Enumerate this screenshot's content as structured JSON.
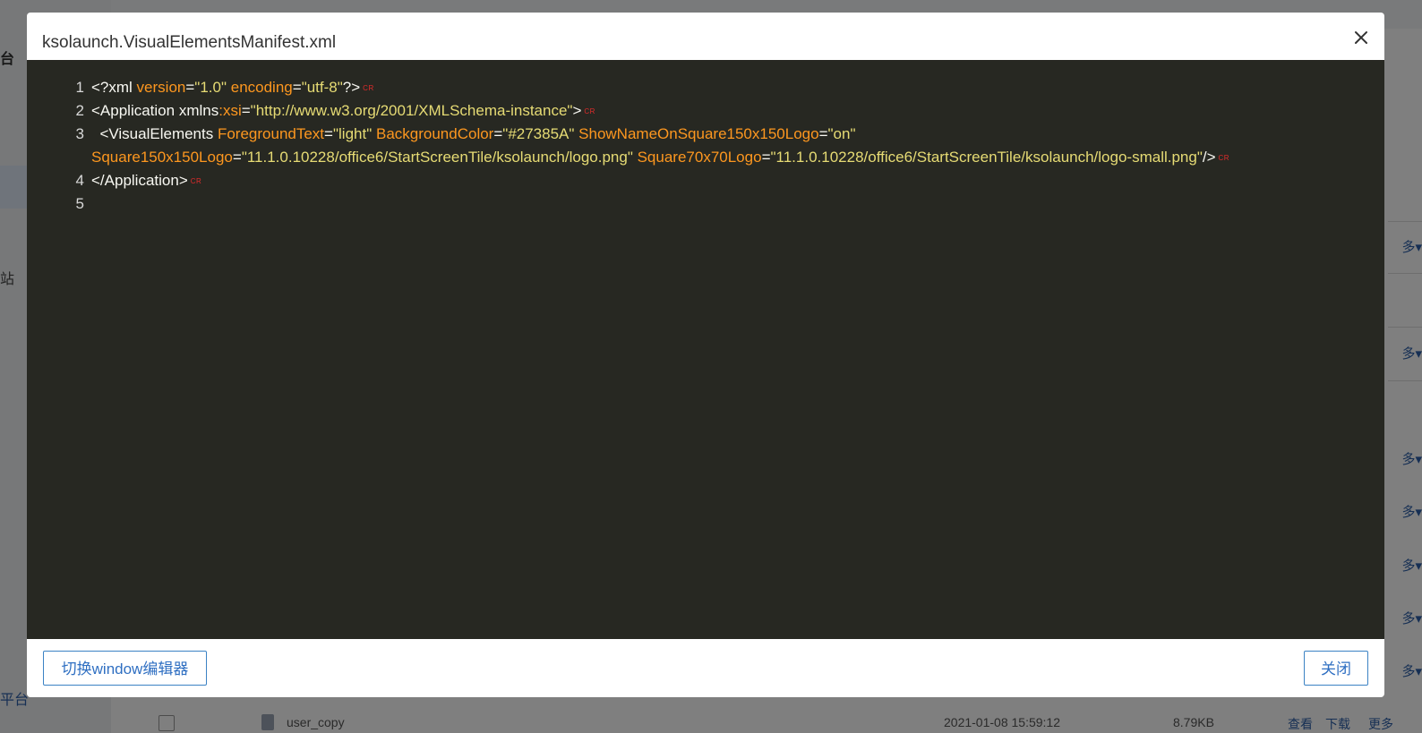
{
  "background": {
    "sidebar_items": [
      "台",
      "站",
      "平台"
    ],
    "more_label": "多",
    "file_row": {
      "name": "user_copy",
      "date": "2021-01-08 15:59:12",
      "size": "8.79KB",
      "actions": [
        "查看",
        "下载",
        "更多"
      ]
    }
  },
  "dialog": {
    "title": "ksolaunch.VisualElementsManifest.xml",
    "close_icon": "close-icon",
    "line_ending_marker": "CR",
    "lines": [
      {
        "number": "1"
      },
      {
        "number": "2"
      },
      {
        "number": "3"
      },
      {
        "number": ""
      },
      {
        "number": "4"
      },
      {
        "number": "5"
      }
    ],
    "code": {
      "l1": {
        "p1": "<?xml ",
        "a1": "version",
        "e1": "=",
        "s1": "\"1.0\"",
        "sp1": " ",
        "a2": "encoding",
        "e2": "=",
        "s2": "\"utf-8\"",
        "end": "?>"
      },
      "l2": {
        "p1": "<Application xmlns",
        "a1": ":xsi",
        "e1": "=",
        "s1": "\"http://www.w3.org/2001/XMLSchema-instance\"",
        "end": ">"
      },
      "l3": {
        "p1": "  <VisualElements ",
        "a1": "ForegroundText",
        "e1": "=",
        "s1": "\"light\"",
        "sp1": " ",
        "a2": "BackgroundColor",
        "e2": "=",
        "s2": "\"#27385A\"",
        "sp2": " ",
        "a3": "ShowNameOnSquare150x150Logo",
        "e3": "=",
        "s3": "\"on\""
      },
      "l3b": {
        "a1": "Square150x150Logo",
        "e1": "=",
        "s1": "\"11.1.0.10228/office6/StartScreenTile/ksolaunch/logo.png\"",
        "sp1": " ",
        "a2": "Square70x70Logo",
        "e2": "=",
        "s2": "\"11.1.0.10228/office6/StartScreenTile/ksolaunch/logo-small.png\"",
        "end": "/>"
      },
      "l4": {
        "p1": "</Application>"
      }
    },
    "buttons": {
      "switch_editor": "切换window编辑器",
      "close": "关闭"
    }
  }
}
